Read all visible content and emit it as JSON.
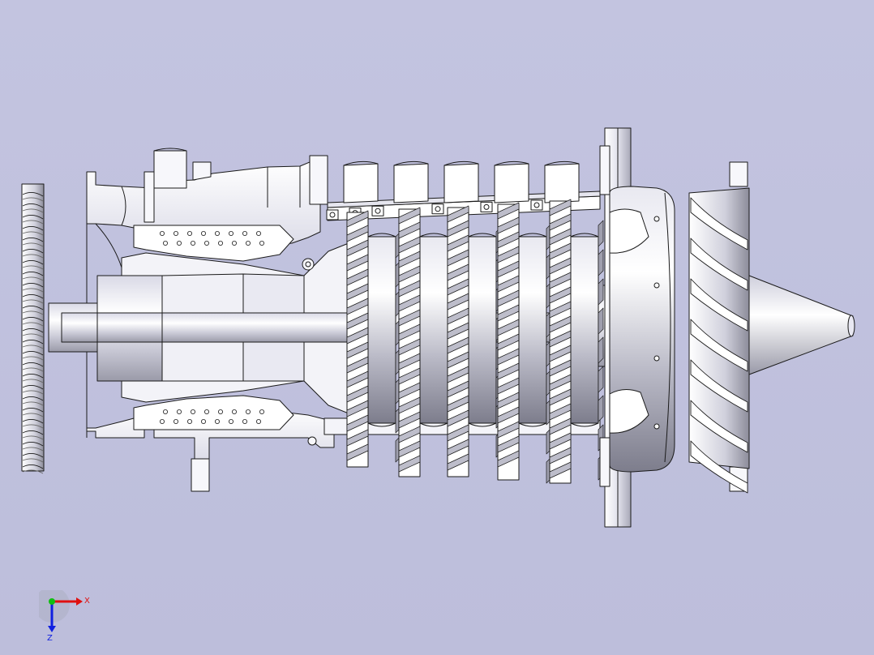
{
  "viewport": {
    "background": "#c1c2de",
    "model_fill": "#f7f7fb",
    "model_edge": "#1a1a1a"
  },
  "triad": {
    "x_label": "X",
    "z_label": "Z",
    "x_color": "#e01010",
    "y_color": "#10c010",
    "z_color": "#1020e0"
  }
}
